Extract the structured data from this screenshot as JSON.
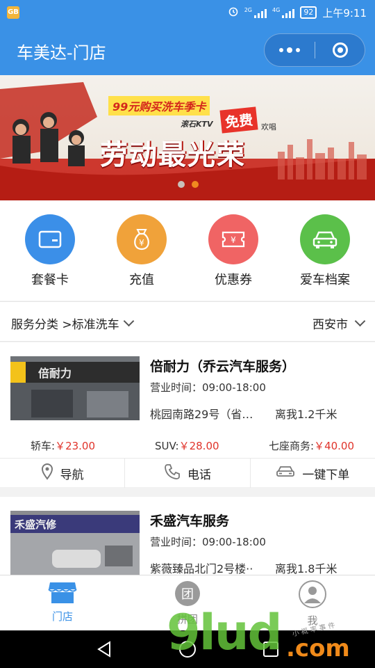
{
  "status_bar": {
    "app_badge": "GB",
    "net1": "2G",
    "net2": "4G",
    "battery": "92",
    "time": "上午9:11"
  },
  "header": {
    "title": "车美达-门店"
  },
  "banner": {
    "promo": "99元购买洗车季卡",
    "ktv": "滚石KTV",
    "free": "免费",
    "sing": "欢唱",
    "slogan": "劳动最光荣",
    "dots_total": 2,
    "dots_active": 2
  },
  "quick_actions": [
    {
      "label": "套餐卡",
      "color": "#3b8fe8",
      "icon": "card-icon"
    },
    {
      "label": "充值",
      "color": "#f0a23a",
      "icon": "money-bag-icon"
    },
    {
      "label": "优惠券",
      "color": "#f06464",
      "icon": "coupon-icon"
    },
    {
      "label": "爱车档案",
      "color": "#5bc04a",
      "icon": "car-icon"
    }
  ],
  "filter": {
    "category": "服务分类 >标准洗车",
    "city": "西安市"
  },
  "stores": [
    {
      "name": "倍耐力（乔云汽车服务）",
      "hours": "营业时间：09:00-18:00",
      "address": "桃园南路29号（省…",
      "distance": "离我1.2千米",
      "prices": [
        {
          "label": "轿车:",
          "value": "￥23.00"
        },
        {
          "label": "SUV:",
          "value": "￥28.00"
        },
        {
          "label": "七座商务:",
          "value": "￥40.00"
        }
      ],
      "actions": {
        "navigate": "导航",
        "phone": "电话",
        "order": "一键下单"
      }
    },
    {
      "name": "禾盛汽车服务",
      "hours": "营业时间：09:00-18:00",
      "address": "紫薇臻品北门2号楼··",
      "distance": "离我1.8千米"
    }
  ],
  "tabs": [
    {
      "label": "门店",
      "active": true
    },
    {
      "label": "拼团",
      "active": false
    },
    {
      "label": "我",
      "active": false
    }
  ],
  "watermark": {
    "main": "9lud",
    "domain": ".com",
    "small": "小 概 率 事 件"
  },
  "colors": {
    "primary": "#3a91e6",
    "price": "#e0332a",
    "tab_active": "#3a91e6"
  }
}
